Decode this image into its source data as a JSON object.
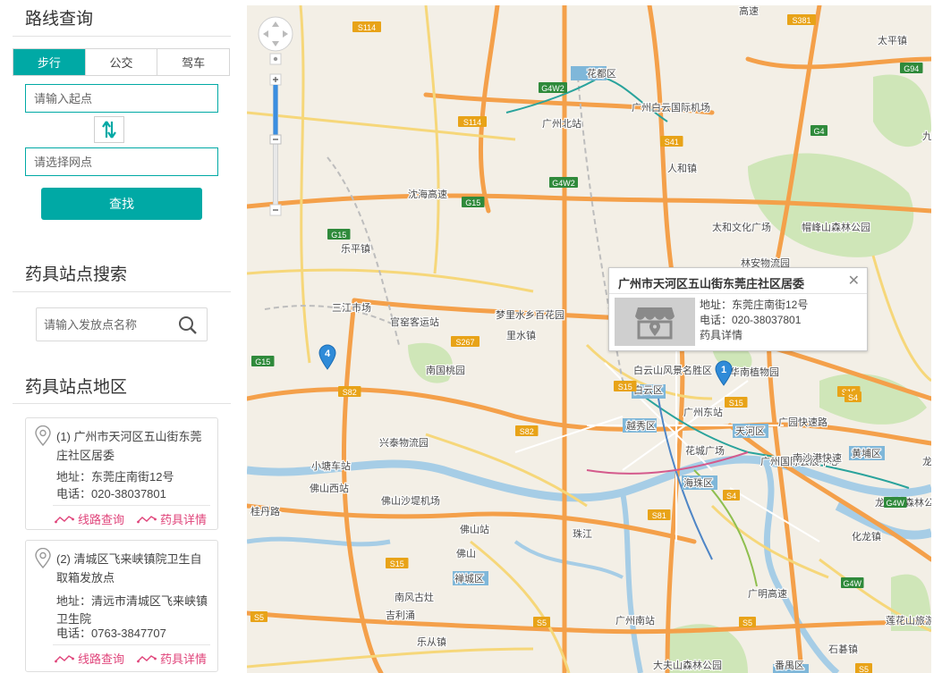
{
  "route": {
    "title": "路线查询",
    "tabs": [
      "步行",
      "公交",
      "驾车"
    ],
    "start_placeholder": "请输入起点",
    "end_placeholder": "请选择网点",
    "find_label": "查找"
  },
  "station_search": {
    "title": "药具站点搜索",
    "placeholder": "请输入发放点名称"
  },
  "region": {
    "title": "药具站点地区",
    "items": [
      {
        "title": "(1) 广州市天河区五山街东莞庄社区居委",
        "address": "地址：东莞庄南街12号",
        "phone": "电话：020-38037801",
        "route_link": "线路查询",
        "detail_link": "药具详情"
      },
      {
        "title": "(2) 清城区飞来峡镇院卫生自取箱发放点",
        "address": "地址：清远市清城区飞来峡镇卫生院",
        "phone": "电话：0763-3847707",
        "route_link": "线路查询",
        "detail_link": "药具详情"
      }
    ]
  },
  "popup": {
    "title": "广州市天河区五山街东莞庄社区居委",
    "address": "地址：东莞庄南街12号",
    "phone": "电话：020-38037801",
    "detail": "药具详情"
  },
  "map": {
    "markers": [
      "1",
      "4"
    ],
    "highway_labels": [
      "S114",
      "S381",
      "G94",
      "G4W2",
      "S114",
      "S41",
      "G4",
      "G4W2",
      "G15",
      "G15",
      "S267",
      "G15",
      "S82",
      "S15",
      "S82",
      "S15",
      "S4",
      "S15",
      "S81",
      "S4",
      "G4W",
      "S15",
      "S5",
      "S5",
      "S5",
      "S5",
      "G4W"
    ],
    "place_labels": [
      {
        "text": "高速"
      },
      {
        "text": "太平镇"
      },
      {
        "text": "花都区"
      },
      {
        "text": "广州白云国际机场"
      },
      {
        "text": "广州北站"
      },
      {
        "text": "人和镇"
      },
      {
        "text": "沈海高速"
      },
      {
        "text": "乐平镇"
      },
      {
        "text": "太和文化广场"
      },
      {
        "text": "帽峰山森林公园"
      },
      {
        "text": "林安物流园"
      },
      {
        "text": "三江市场"
      },
      {
        "text": "官窑客运站"
      },
      {
        "text": "梦里水乡百花园"
      },
      {
        "text": "里水镇"
      },
      {
        "text": "南国桃园"
      },
      {
        "text": "白云山风景名胜区"
      },
      {
        "text": "华南植物园"
      },
      {
        "text": "白云区"
      },
      {
        "text": "广州东站"
      },
      {
        "text": "越秀区"
      },
      {
        "text": "天河区"
      },
      {
        "text": "广园快速路"
      },
      {
        "text": "兴泰物流园"
      },
      {
        "text": "小塘车站"
      },
      {
        "text": "广州国际会展中心"
      },
      {
        "text": "黄埔区"
      },
      {
        "text": "花城广场"
      },
      {
        "text": "佛山西站"
      },
      {
        "text": "佛山沙堤机场"
      },
      {
        "text": "海珠区"
      },
      {
        "text": "桂丹路"
      },
      {
        "text": "佛山站"
      },
      {
        "text": "佛山"
      },
      {
        "text": "禅城区"
      },
      {
        "text": "珠江"
      },
      {
        "text": "南风古灶"
      },
      {
        "text": "吉利涌"
      },
      {
        "text": "广州南站"
      },
      {
        "text": "广明高速"
      },
      {
        "text": "化龙镇"
      },
      {
        "text": "莲花山旅游区"
      },
      {
        "text": "乐从镇"
      },
      {
        "text": "大夫山森林公园"
      },
      {
        "text": "番禺区"
      },
      {
        "text": "石碁镇"
      },
      {
        "text": "九佛"
      },
      {
        "text": "南沙港快速"
      },
      {
        "text": "龙头山森林公园"
      },
      {
        "text": "龙"
      }
    ]
  }
}
